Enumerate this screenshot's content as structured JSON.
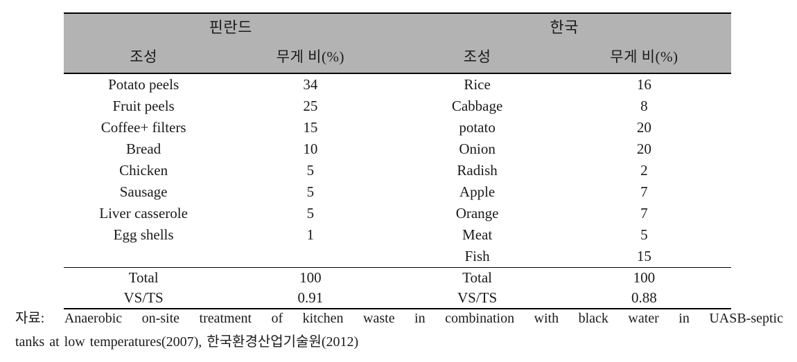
{
  "table": {
    "sections": [
      {
        "country_label": "핀란드",
        "col_name_header": "조성",
        "col_value_header": "무게 비(%)",
        "rows": [
          {
            "name": "Potato peels",
            "value": "34"
          },
          {
            "name": "Fruit peels",
            "value": "25"
          },
          {
            "name": "Coffee+ filters",
            "value": "15"
          },
          {
            "name": "Bread",
            "value": "10"
          },
          {
            "name": "Chicken",
            "value": "5"
          },
          {
            "name": "Sausage",
            "value": "5"
          },
          {
            "name": "Liver casserole",
            "value": "5"
          },
          {
            "name": "Egg shells",
            "value": "1"
          }
        ],
        "summary": [
          {
            "name": "Total",
            "value": "100"
          },
          {
            "name": "VS/TS",
            "value": "0.91"
          }
        ]
      },
      {
        "country_label": "한국",
        "col_name_header": "조성",
        "col_value_header": "무게 비(%)",
        "rows": [
          {
            "name": "Rice",
            "value": "16"
          },
          {
            "name": "Cabbage",
            "value": "8"
          },
          {
            "name": "potato",
            "value": "20"
          },
          {
            "name": "Onion",
            "value": "20"
          },
          {
            "name": "Radish",
            "value": "2"
          },
          {
            "name": "Apple",
            "value": "7"
          },
          {
            "name": "Orange",
            "value": "7"
          },
          {
            "name": "Meat",
            "value": "5"
          },
          {
            "name": "Fish",
            "value": "15"
          }
        ],
        "summary": [
          {
            "name": "Total",
            "value": "100"
          },
          {
            "name": "VS/TS",
            "value": "0.88"
          }
        ]
      }
    ]
  },
  "source": {
    "line1": "자료: Anaerobic on-site treatment of kitchen waste in combination with black water in UASB-septic",
    "line2": "tanks at low temperatures(2007), 한국환경산업기술원(2012)"
  },
  "colors": {
    "header_band": "#b3b3b3",
    "rule": "#000000",
    "text": "#1a1a1a",
    "page_background": "#ffffff"
  }
}
